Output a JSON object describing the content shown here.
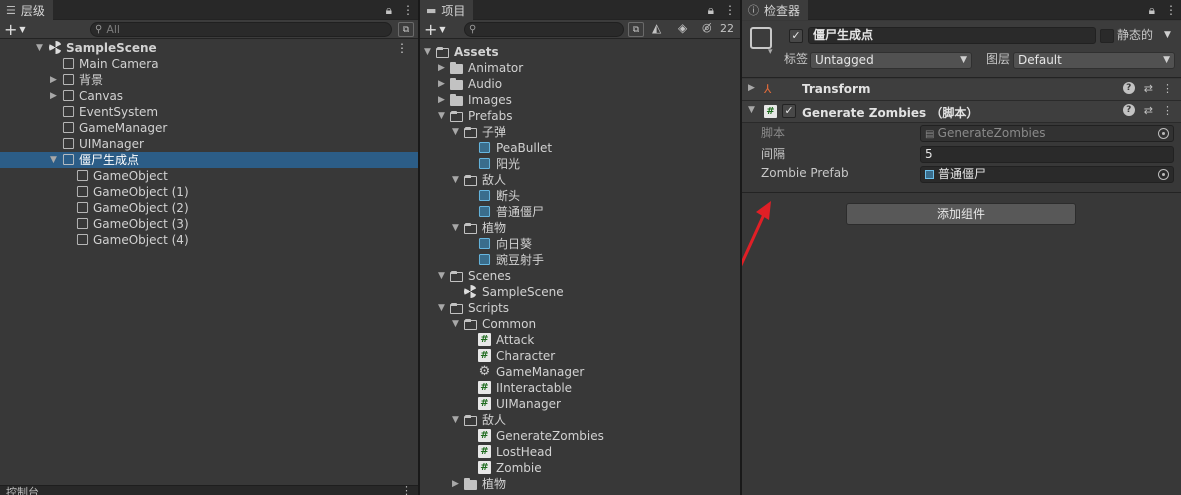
{
  "hierarchy": {
    "tab_label": "层级",
    "search_placeholder": "All",
    "scene": "SampleScene",
    "items": [
      {
        "label": "Main Camera",
        "expandable": false
      },
      {
        "label": "背景",
        "expandable": true
      },
      {
        "label": "Canvas",
        "expandable": true
      },
      {
        "label": "EventSystem",
        "expandable": false
      },
      {
        "label": "GameManager",
        "expandable": false
      },
      {
        "label": "UIManager",
        "expandable": false
      },
      {
        "label": "僵尸生成点",
        "expandable": true,
        "selected": true
      },
      {
        "label": "GameObject",
        "child": true
      },
      {
        "label": "GameObject (1)",
        "child": true
      },
      {
        "label": "GameObject (2)",
        "child": true
      },
      {
        "label": "GameObject (3)",
        "child": true
      },
      {
        "label": "GameObject (4)",
        "child": true
      }
    ],
    "bottom_tab_label": "控制台"
  },
  "project": {
    "tab_label": "项目",
    "hidden_count": "22",
    "tree": [
      {
        "label": "Assets",
        "depth": 0,
        "icon": "folder-open",
        "arrow": "down",
        "bold": true
      },
      {
        "label": "Animator",
        "depth": 1,
        "icon": "folder",
        "arrow": "right"
      },
      {
        "label": "Audio",
        "depth": 1,
        "icon": "folder",
        "arrow": "right"
      },
      {
        "label": "Images",
        "depth": 1,
        "icon": "folder",
        "arrow": "right"
      },
      {
        "label": "Prefabs",
        "depth": 1,
        "icon": "folder-open",
        "arrow": "down"
      },
      {
        "label": "子弹",
        "depth": 2,
        "icon": "folder-open",
        "arrow": "down"
      },
      {
        "label": "PeaBullet",
        "depth": 3,
        "icon": "prefab"
      },
      {
        "label": "阳光",
        "depth": 3,
        "icon": "prefab"
      },
      {
        "label": "敌人",
        "depth": 2,
        "icon": "folder-open",
        "arrow": "down"
      },
      {
        "label": "断头",
        "depth": 3,
        "icon": "prefab"
      },
      {
        "label": "普通僵尸",
        "depth": 3,
        "icon": "prefab"
      },
      {
        "label": "植物",
        "depth": 2,
        "icon": "folder-open",
        "arrow": "down"
      },
      {
        "label": "向日葵",
        "depth": 3,
        "icon": "prefab"
      },
      {
        "label": "豌豆射手",
        "depth": 3,
        "icon": "prefab"
      },
      {
        "label": "Scenes",
        "depth": 1,
        "icon": "folder-open",
        "arrow": "down"
      },
      {
        "label": "SampleScene",
        "depth": 2,
        "icon": "scene"
      },
      {
        "label": "Scripts",
        "depth": 1,
        "icon": "folder-open",
        "arrow": "down"
      },
      {
        "label": "Common",
        "depth": 2,
        "icon": "folder-open",
        "arrow": "down"
      },
      {
        "label": "Attack",
        "depth": 3,
        "icon": "script"
      },
      {
        "label": "Character",
        "depth": 3,
        "icon": "script"
      },
      {
        "label": "GameManager",
        "depth": 3,
        "icon": "gear"
      },
      {
        "label": "IInteractable",
        "depth": 3,
        "icon": "script"
      },
      {
        "label": "UIManager",
        "depth": 3,
        "icon": "script"
      },
      {
        "label": "敌人",
        "depth": 2,
        "icon": "folder-open",
        "arrow": "down"
      },
      {
        "label": "GenerateZombies",
        "depth": 3,
        "icon": "script"
      },
      {
        "label": "LostHead",
        "depth": 3,
        "icon": "script"
      },
      {
        "label": "Zombie",
        "depth": 3,
        "icon": "script"
      },
      {
        "label": "植物",
        "depth": 2,
        "icon": "folder",
        "arrow": "right"
      }
    ]
  },
  "inspector": {
    "tab_label": "检查器",
    "object_name": "僵尸生成点",
    "static_label": "静态的",
    "tag_label": "标签",
    "tag_value": "Untagged",
    "layer_label": "图层",
    "layer_value": "Default",
    "components": [
      {
        "title": "Transform"
      },
      {
        "title": "Generate Zombies （脚本）"
      }
    ],
    "script_label": "脚本",
    "script_value": "GenerateZombies",
    "interval_label": "间隔",
    "interval_value": "5",
    "prefab_label": "Zombie Prefab",
    "prefab_value": "普通僵尸",
    "add_component": "添加组件"
  },
  "colors": {
    "selection": "#2c5d87",
    "annotation_arrow": "#e01f26",
    "script_icon": "#1e6b1e",
    "prefab_icon": "#6cc0ec"
  }
}
